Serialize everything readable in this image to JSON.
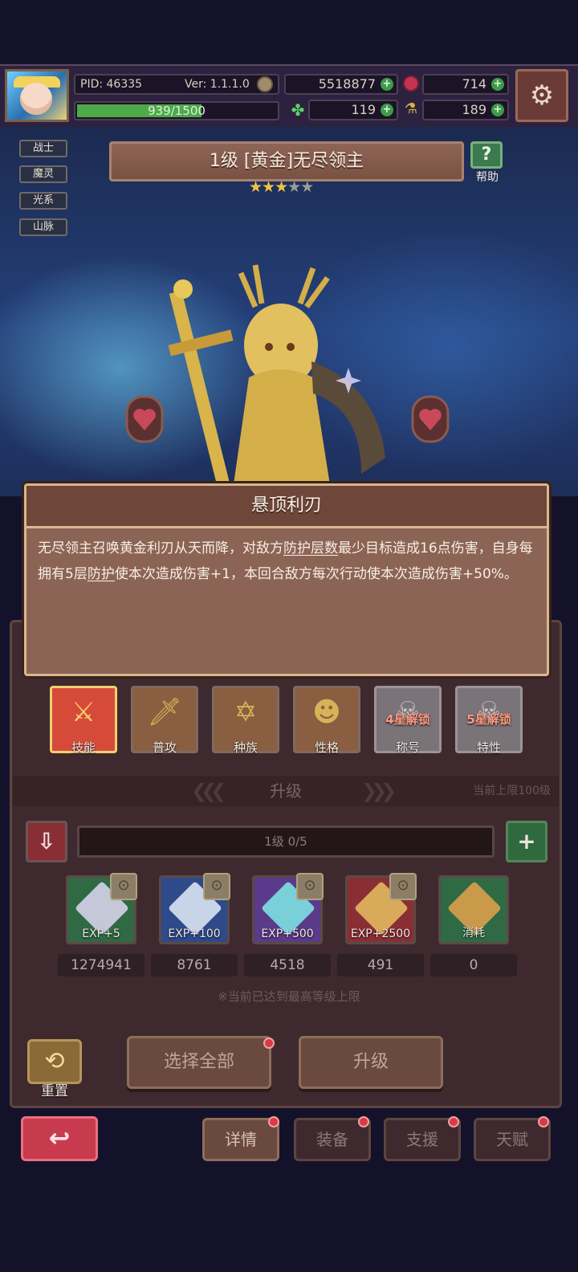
{
  "player": {
    "pid": "PID: 46335",
    "version": "Ver: 1.1.1.0",
    "gold": "5518877",
    "gems": "714",
    "clover": "119",
    "potion": "189",
    "exp_text": "939/1500",
    "exp_progress": 0.626
  },
  "hero": {
    "tags": [
      "战士",
      "魔灵",
      "光系",
      "山脉"
    ],
    "title": "1级 [黄金]无尽领主",
    "stars_filled": 3,
    "stars_total": 5,
    "help_label": "帮助"
  },
  "popup": {
    "title": "悬顶利刃",
    "text_1": "无尽领主召唤黄金利刃从天而降，对敌方",
    "link_1": "防护层数",
    "text_2": "最少目标造成16点伤害，自身每拥有5层",
    "link_2": "防护",
    "text_3": "使本次造成伤害+1，本回合敌方每次行动使本次造成伤害+50%。"
  },
  "skill_tabs": [
    {
      "label": "技能",
      "icon": "sword-circle-icon",
      "state": "active"
    },
    {
      "label": "普攻",
      "icon": "sword-icon",
      "state": "normal"
    },
    {
      "label": "种族",
      "icon": "star-of-david-icon",
      "state": "normal"
    },
    {
      "label": "性格",
      "icon": "character-icon",
      "state": "normal"
    },
    {
      "label": "称号",
      "icon": "mask-icon",
      "state": "locked",
      "lock_text": "4星解锁"
    },
    {
      "label": "特性",
      "icon": "mask-icon",
      "state": "locked",
      "lock_text": "5星解锁"
    }
  ],
  "upgrade": {
    "section_title": "升级",
    "limit_text": "当前上限100级",
    "level_text": "1级  0/5",
    "max_note": "※当前已达到最高等级上限",
    "select_all": "选择全部",
    "upgrade_btn": "升级",
    "reset": "重置"
  },
  "items": [
    {
      "caption": "EXP+5",
      "count": "1274941",
      "color": "#2f6a44",
      "gem": "#c4c8d8"
    },
    {
      "caption": "EXP+100",
      "count": "8761",
      "color": "#2e4a8a",
      "gem": "#c8d4e8"
    },
    {
      "caption": "EXP+500",
      "count": "4518",
      "color": "#5a3a8a",
      "gem": "#7ad0d8"
    },
    {
      "caption": "EXP+2500",
      "count": "491",
      "color": "#8a2e36",
      "gem": "#d8aa5a"
    },
    {
      "caption": "消耗",
      "count": "0",
      "color": "#2f6a44",
      "gem": "#c89a4a"
    }
  ],
  "nav": {
    "details": "详情",
    "equipment": "装备",
    "support": "支援",
    "talent": "天赋"
  }
}
